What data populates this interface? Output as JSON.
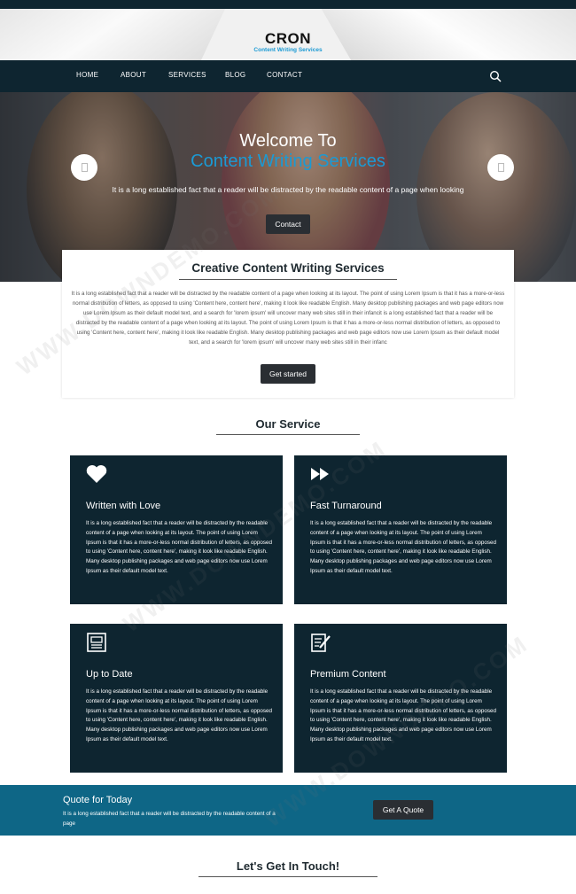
{
  "brand": {
    "name": "CRON",
    "tagline": "Content Writing Services"
  },
  "nav": {
    "items": [
      {
        "label": "HOME"
      },
      {
        "label": "ABOUT"
      },
      {
        "label": "SERVICES"
      },
      {
        "label": "BLOG"
      },
      {
        "label": "CONTACT"
      }
    ],
    "search_icon": "search-icon"
  },
  "hero": {
    "title": "Welcome To",
    "subtitle": "Content Writing Services",
    "text": "It is a long established fact that a reader will be distracted by the readable content of a page when looking",
    "button_label": "Contact"
  },
  "intro": {
    "title": "Creative Content Writing Services",
    "text": "It is a long established fact that a reader will be distracted by the readable content of a page when looking at its layout. The point of using Lorem Ipsum is that it has a more-or-less normal distribution of letters, as opposed to using 'Content here, content here', making it look like readable English. Many desktop publishing packages and web page editors now use Lorem Ipsum as their default model text, and a search for 'lorem ipsum' will uncover many web sites still in their infancit is a long established fact that a reader will be distracted by the readable content of a page when looking at its layout. The point of using Lorem Ipsum is that it has a more-or-less normal distribution of letters, as opposed to using 'Content here, content here', making it look like readable English. Many desktop publishing packages and web page editors now use Lorem Ipsum as their default model text, and a search for 'lorem ipsum' will uncover many web sites still in their infanc",
    "button_label": "Get started"
  },
  "services": {
    "title": "Our Service",
    "items": [
      {
        "name": "Written with Love",
        "icon": "heart-icon",
        "text": "It is a long established fact that a reader will be distracted by the readable content of a page when looking at its layout. The point of using Lorem Ipsum is that it has a more-or-less normal distribution of letters, as opposed to using 'Content here, content here', making it look like readable English. Many desktop publishing packages and web page editors now use Lorem Ipsum as their default model text."
      },
      {
        "name": "Fast Turnaround",
        "icon": "fast-forward-icon",
        "text": "It is a long established fact that a reader will be distracted by the readable content of a page when looking at its layout. The point of using Lorem Ipsum is that it has a more-or-less normal distribution of letters, as opposed to using 'Content here, content here', making it look like readable English. Many desktop publishing packages and web page editors now use Lorem Ipsum as their default model text."
      },
      {
        "name": "Up to Date",
        "icon": "newspaper-icon",
        "text": "It is a long established fact that a reader will be distracted by the readable content of a page when looking at its layout. The point of using Lorem Ipsum is that it has a more-or-less normal distribution of letters, as opposed to using 'Content here, content here', making it look like readable English. Many desktop publishing packages and web page editors now use Lorem Ipsum as their default model text."
      },
      {
        "name": "Premium Content",
        "icon": "document-edit-icon",
        "text": "It is a long established fact that a reader will be distracted by the readable content of a page when looking at its layout. The point of using Lorem Ipsum is that it has a more-or-less normal distribution of letters, as opposed to using 'Content here, content here', making it look like readable English. Many desktop publishing packages and web page editors now use Lorem Ipsum as their default model text."
      }
    ]
  },
  "quote": {
    "title": "Quote for Today",
    "text": "It is a long established fact that a reader will be distracted by the readable content of a page",
    "button_label": "Get A Quote"
  },
  "contact": {
    "title": "Let's Get In Touch!"
  },
  "watermark": "WWW.DOWNDEMO.COM",
  "colors": {
    "navy": "#0e2530",
    "accent_blue": "#1b9ad4",
    "quote_band": "#0e6686",
    "button": "#2a2e33"
  }
}
